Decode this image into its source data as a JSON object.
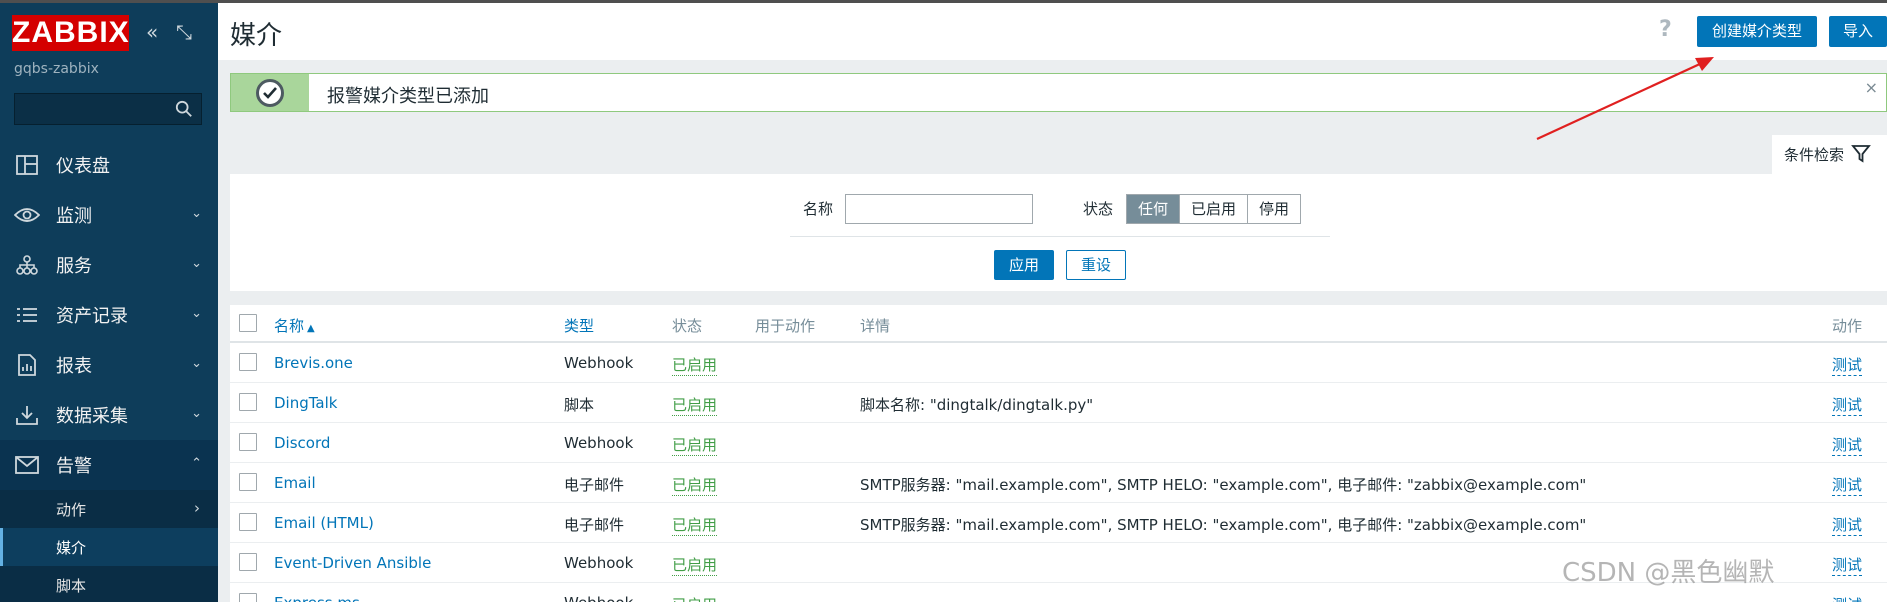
{
  "app": {
    "logo": "ZABBIX",
    "server_name": "gqbs-zabbix",
    "collapse_glyph": "«",
    "kiosk_glyph": "⤡"
  },
  "search": {
    "value": "",
    "placeholder": ""
  },
  "menu": [
    {
      "label": "仪表盘",
      "icon": "dashboard-icon",
      "arrow": ""
    },
    {
      "label": "监测",
      "icon": "eye-icon",
      "arrow": "⌄"
    },
    {
      "label": "服务",
      "icon": "services-icon",
      "arrow": "⌄"
    },
    {
      "label": "资产记录",
      "icon": "list-icon",
      "arrow": "⌄"
    },
    {
      "label": "报表",
      "icon": "report-icon",
      "arrow": "⌄"
    },
    {
      "label": "数据采集",
      "icon": "download-icon",
      "arrow": "⌄"
    },
    {
      "label": "告警",
      "icon": "envelope-icon",
      "arrow": "⌃"
    }
  ],
  "submenu": [
    {
      "label": "动作",
      "arrow": "›"
    },
    {
      "label": "媒介",
      "arrow": ""
    },
    {
      "label": "脚本",
      "arrow": ""
    }
  ],
  "header": {
    "title": "媒介",
    "help": "?",
    "create_label": "创建媒介类型",
    "import_label": "导入"
  },
  "message": {
    "text": "报警媒介类型已添加",
    "close": "×"
  },
  "filter": {
    "tab_label": "条件检索",
    "name_label": "名称",
    "name_value": "",
    "status_label": "状态",
    "status_options": [
      "任何",
      "已启用",
      "停用"
    ],
    "status_selected": "任何",
    "apply_label": "应用",
    "reset_label": "重设"
  },
  "table": {
    "headers": {
      "name": "名称",
      "sort_glyph": "▲",
      "type": "类型",
      "status": "状态",
      "used": "用于动作",
      "details": "详情",
      "action": "动作"
    },
    "rows": [
      {
        "name": "Brevis.one",
        "type": "Webhook",
        "status": "已启用",
        "used": "",
        "details": "",
        "action": "测试"
      },
      {
        "name": "DingTalk",
        "type": "脚本",
        "status": "已启用",
        "used": "",
        "details": "脚本名称: \"dingtalk/dingtalk.py\"",
        "action": "测试"
      },
      {
        "name": "Discord",
        "type": "Webhook",
        "status": "已启用",
        "used": "",
        "details": "",
        "action": "测试"
      },
      {
        "name": "Email",
        "type": "电子邮件",
        "status": "已启用",
        "used": "",
        "details": "SMTP服务器: \"mail.example.com\", SMTP HELO: \"example.com\", 电子邮件: \"zabbix@example.com\"",
        "action": "测试"
      },
      {
        "name": "Email (HTML)",
        "type": "电子邮件",
        "status": "已启用",
        "used": "",
        "details": "SMTP服务器: \"mail.example.com\", SMTP HELO: \"example.com\", 电子邮件: \"zabbix@example.com\"",
        "action": "测试"
      },
      {
        "name": "Event-Driven Ansible",
        "type": "Webhook",
        "status": "已启用",
        "used": "",
        "details": "",
        "action": "测试"
      },
      {
        "name": "Express.ms",
        "type": "Webhook",
        "status": "已启用",
        "used": "",
        "details": "",
        "action": "测试"
      }
    ]
  },
  "watermark": "CSDN @黑色幽默",
  "colors": {
    "sidebar": "#0e3d5a",
    "accent": "#0275b8",
    "logo": "#d40000",
    "enabled": "#429e47",
    "annotation": "#e02020"
  }
}
